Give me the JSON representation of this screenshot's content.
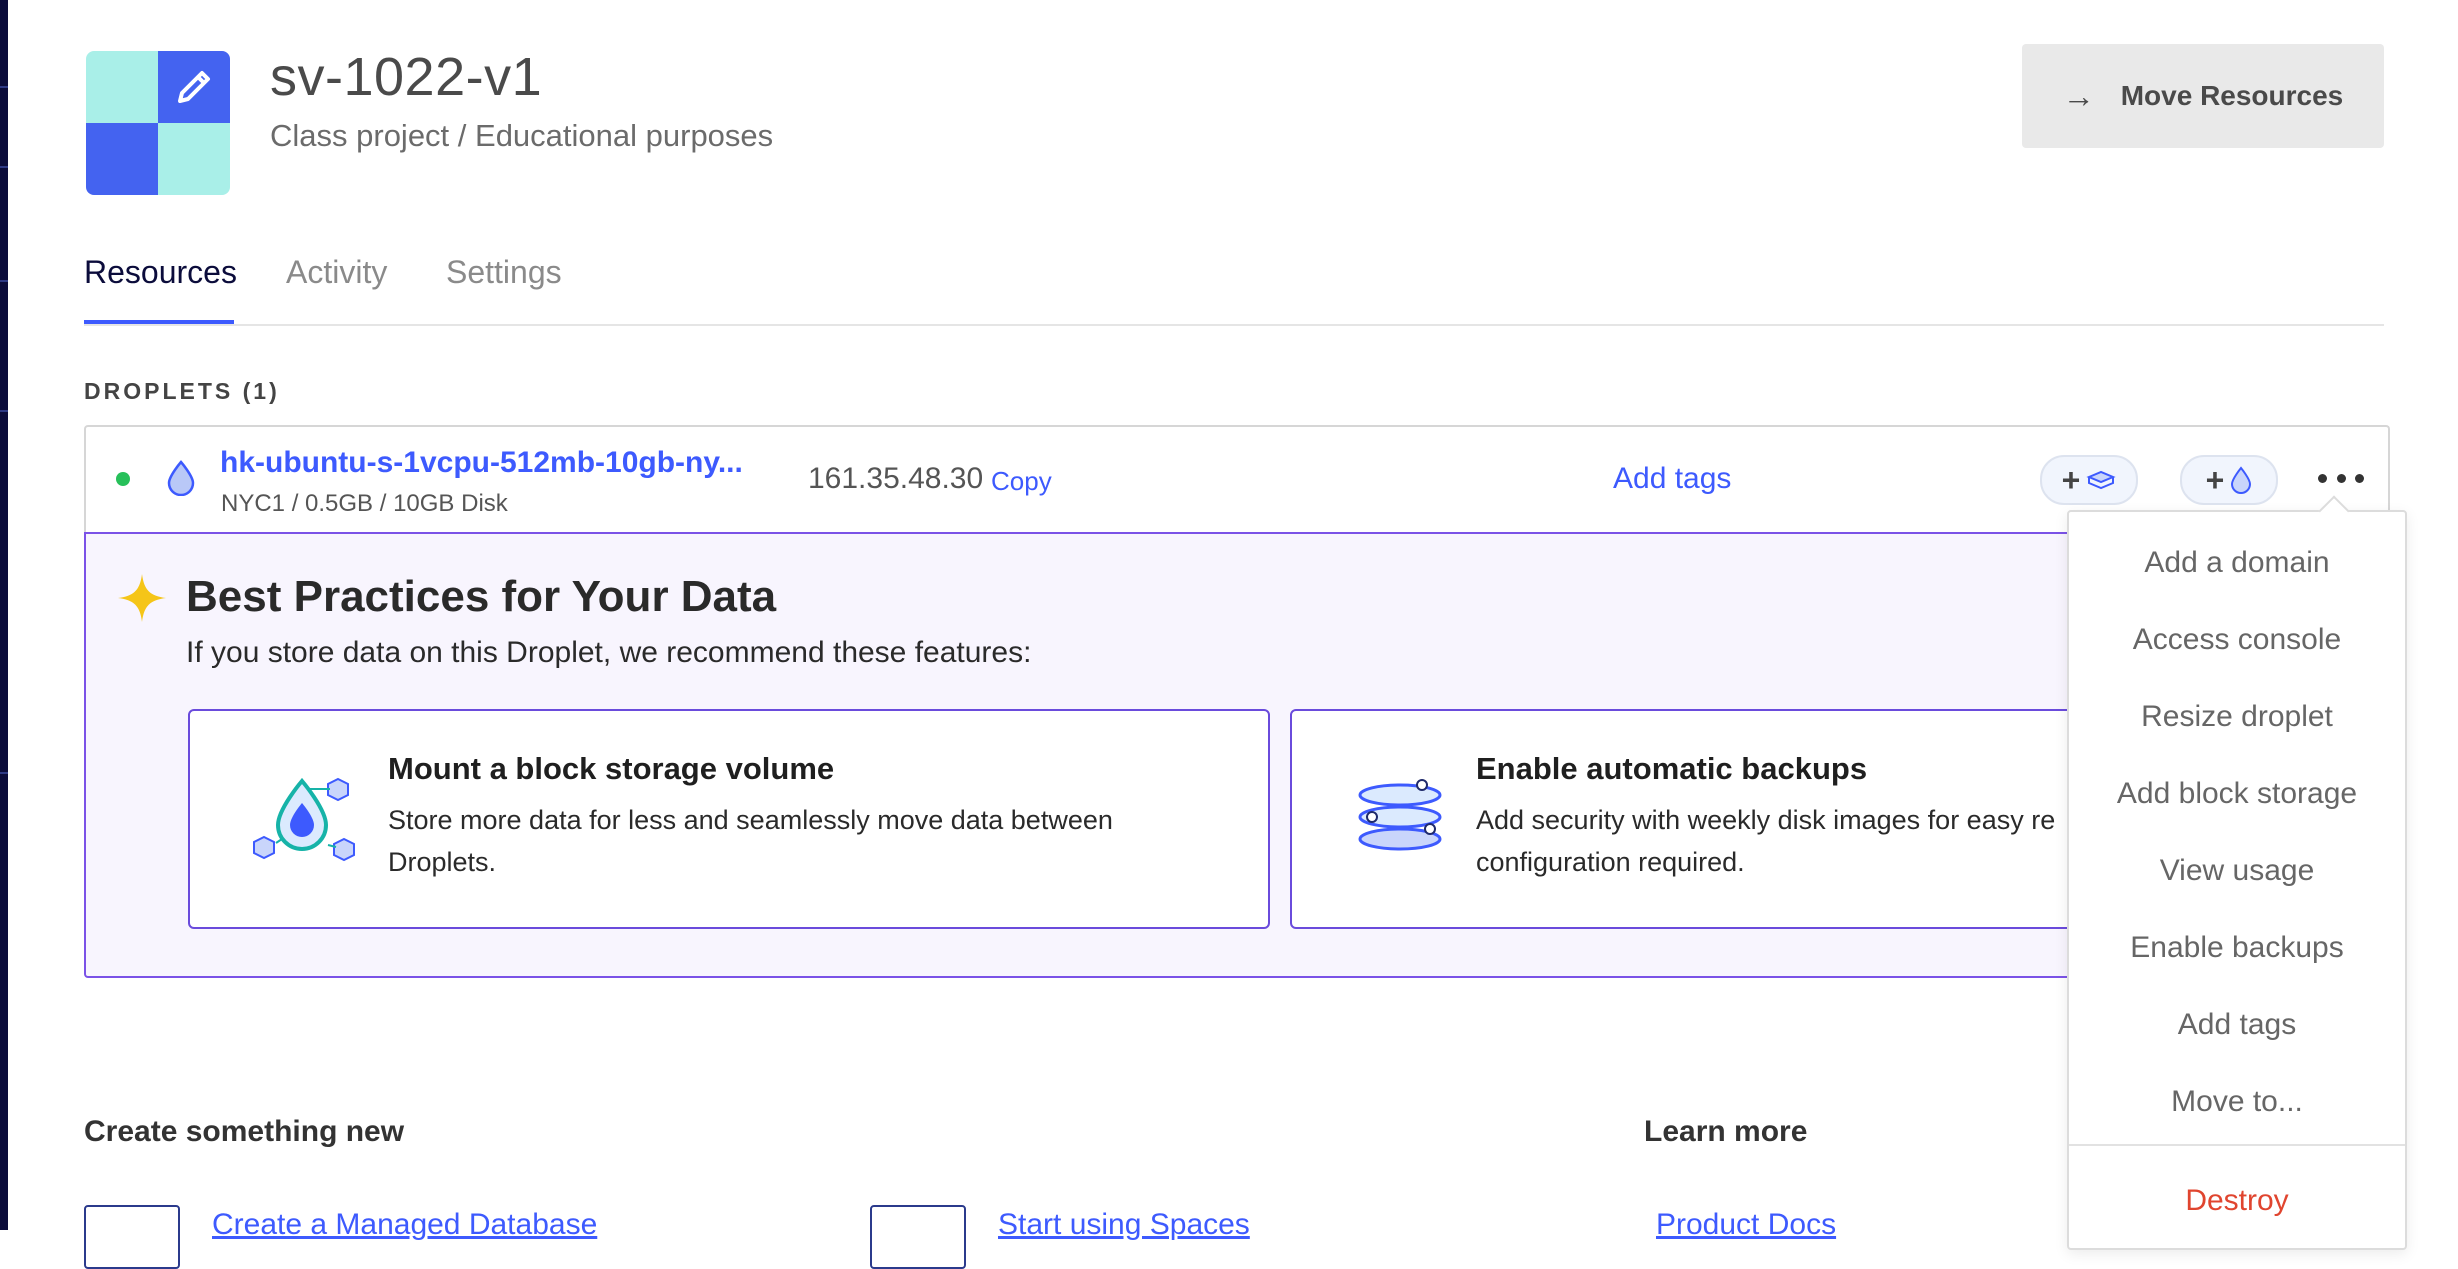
{
  "project": {
    "name": "sv-1022-v1",
    "description": "Class project / Educational purposes"
  },
  "header": {
    "move_resources_label": "Move Resources",
    "move_arrow_glyph": "→"
  },
  "tabs": [
    {
      "label": "Resources",
      "active": true
    },
    {
      "label": "Activity",
      "active": false
    },
    {
      "label": "Settings",
      "active": false
    }
  ],
  "droplets_section": {
    "title": "DROPLETS (1)"
  },
  "droplet": {
    "status": "active",
    "status_color": "#27c05a",
    "name": "hk-ubuntu-s-1vcpu-512mb-10gb-ny...",
    "meta": "NYC1 / 0.5GB / 10GB Disk",
    "ip": "161.35.48.30",
    "copy_label": "Copy",
    "add_tags_label": "Add tags",
    "add_volume_icon": "volume-icon",
    "add_droplet_icon": "droplet-icon"
  },
  "best_practices": {
    "title": "Best Practices for Your Data",
    "subtitle": "If you store data on this Droplet, we recommend these features:",
    "cards": [
      {
        "title": "Mount a block storage volume",
        "description": "Store more data for less and seamlessly move data between Droplets.",
        "icon": "block-storage-icon"
      },
      {
        "title": "Enable automatic backups",
        "description": "Add security with weekly disk images for easy re configuration required.",
        "icon": "backups-icon"
      }
    ]
  },
  "menu": {
    "items": [
      "Add a domain",
      "Access console",
      "Resize droplet",
      "Add block storage",
      "View usage",
      "Enable backups",
      "Add tags",
      "Move to..."
    ],
    "destroy_label": "Destroy"
  },
  "bottom": {
    "create_heading": "Create something new",
    "learn_heading": "Learn more",
    "links": {
      "database": "Create a Managed Database",
      "spaces": "Start using Spaces",
      "docs": "Product Docs"
    }
  },
  "colors": {
    "accent": "#3d5afe",
    "panel_border": "#7b52e7",
    "panel_bg": "#f8f5fe",
    "danger": "#e0452f",
    "sidebar": "#0b0c3b"
  }
}
